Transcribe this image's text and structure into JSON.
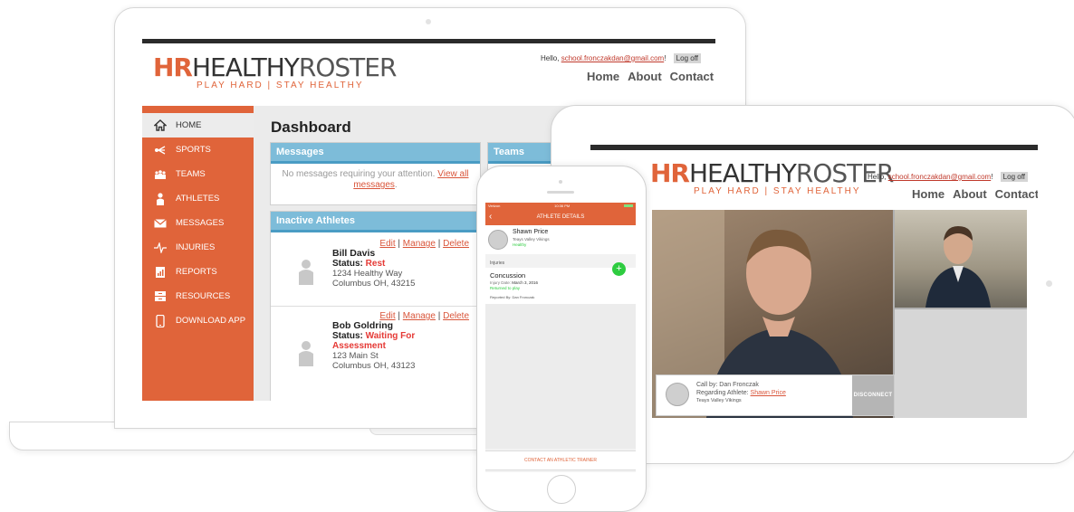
{
  "laptop": {
    "logo": {
      "prefix": "HR",
      "main": "HEALTHY",
      "second": "ROSTER",
      "tagline": "PLAY HARD | STAY HEALTHY"
    },
    "header": {
      "hello_prefix": "Hello, ",
      "email": "school.fronczakdan@gmail.com",
      "hello_suffix": "!",
      "logoff": "Log off",
      "nav": [
        "Home",
        "About",
        "Contact"
      ]
    },
    "sidebar": [
      {
        "label": "HOME",
        "icon": "home-icon"
      },
      {
        "label": "SPORTS",
        "icon": "sports-icon"
      },
      {
        "label": "TEAMS",
        "icon": "teams-icon"
      },
      {
        "label": "ATHLETES",
        "icon": "athlete-icon"
      },
      {
        "label": "MESSAGES",
        "icon": "envelope-icon"
      },
      {
        "label": "INJURIES",
        "icon": "pulse-icon"
      },
      {
        "label": "REPORTS",
        "icon": "report-icon"
      },
      {
        "label": "RESOURCES",
        "icon": "resources-icon"
      },
      {
        "label": "DOWNLOAD APP",
        "icon": "phone-icon"
      }
    ],
    "dashboard_title": "Dashboard",
    "messages_panel": {
      "title": "Messages",
      "text": "No messages requiring your attention.",
      "link": "View all messages",
      "suffix": "."
    },
    "teams_panel": {
      "title": "Teams"
    },
    "inactive_panel": {
      "title": "Inactive Athletes",
      "athletes": [
        {
          "edit": "Edit",
          "manage": "Manage",
          "delete": "Delete",
          "name": "Bill Davis",
          "status_label": "Status: ",
          "status": "Rest",
          "street": "1234 Healthy Way",
          "city": "Columbus OH, 43215"
        },
        {
          "edit": "Edit",
          "manage": "Manage",
          "delete": "Delete",
          "name": "Bob Goldring",
          "status_label": "Status: ",
          "status": "Waiting For Assessment",
          "street": "123 Main St",
          "city": "Columbus OH, 43123"
        }
      ],
      "sep": " | "
    }
  },
  "phone": {
    "status_left": "Verizon",
    "status_time": "10:36 PM",
    "title": "ATHLETE DETAILS",
    "athlete_name": "Shawn Price",
    "athlete_team": "Teays Valley Vikings",
    "athlete_status": "Healthy",
    "section": "Injuries",
    "injury": "Concussion",
    "injury_date_label": "Injury Date:",
    "injury_date": "March 3, 2016",
    "injury_state": "Returned to play",
    "reported_by": "Reported By: Dan Fronczak",
    "footer": "CONTACT AN ATHLETIC TRAINER",
    "accent": "#e0643a",
    "green": "#2ecc40"
  },
  "tablet": {
    "hello_prefix": "Hello, ",
    "email": "school.fronczakdan@gmail.com",
    "hello_suffix": "!",
    "logoff": "Log off",
    "nav": [
      "Home",
      "About",
      "Contact"
    ],
    "call_by": "Call by: Dan Fronczak",
    "regarding_label": "Regarding Athlete: ",
    "regarding_name": "Shawn Price",
    "team": "Teays Valley Vikings",
    "disconnect": "DISCONNECT"
  }
}
